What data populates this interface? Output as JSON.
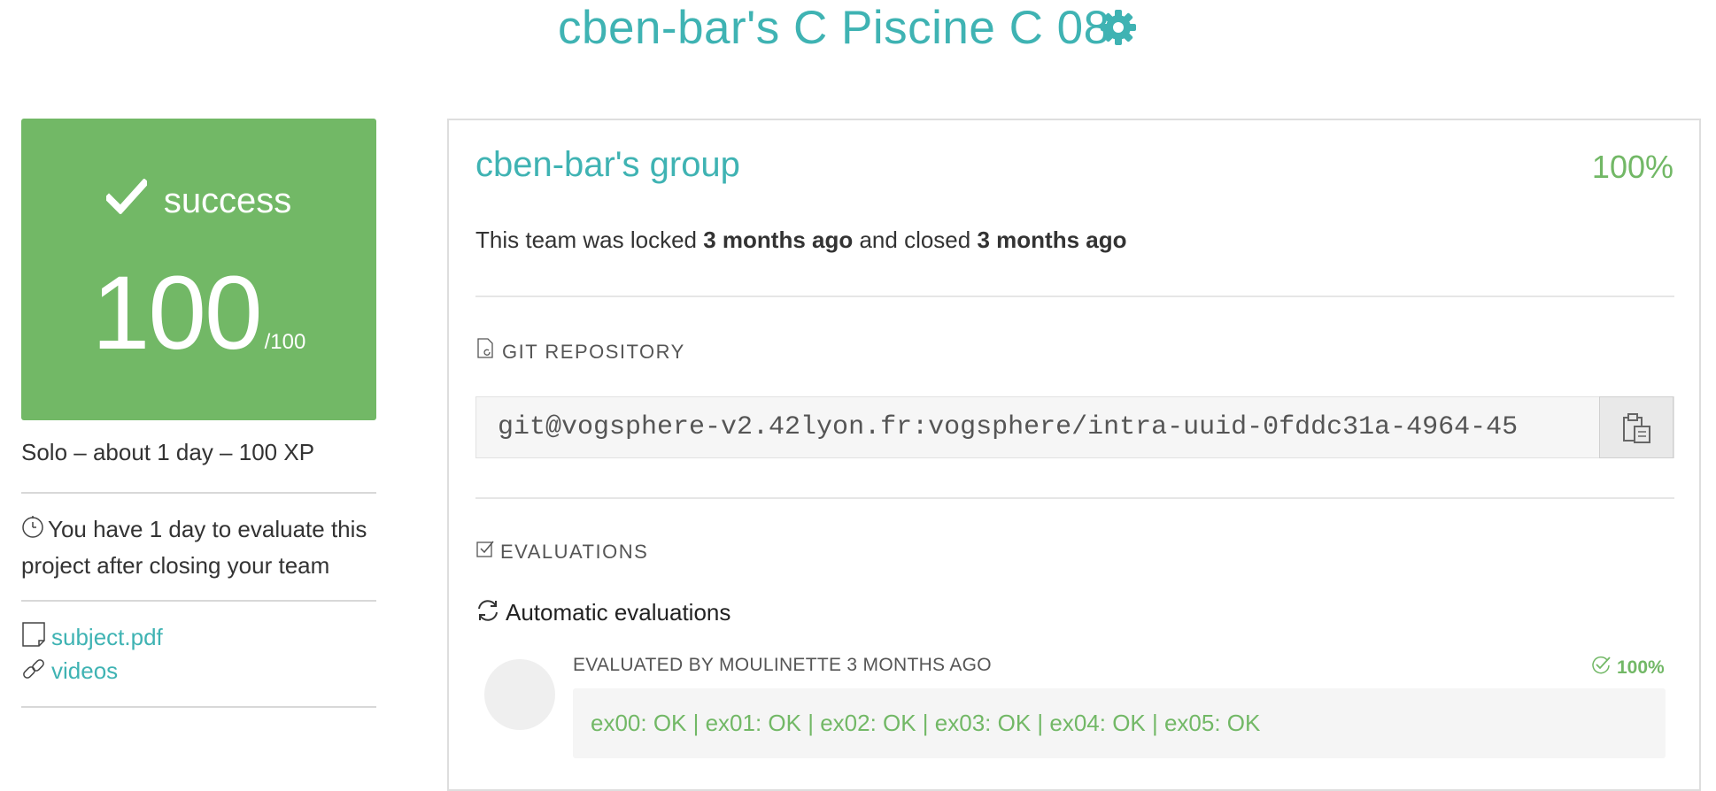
{
  "header": {
    "title": "cben-bar's C Piscine C 08",
    "settings_icon": "gear-icon"
  },
  "colors": {
    "accent": "#3fb3b3",
    "success": "#72b866"
  },
  "score_card": {
    "status": "success",
    "status_icon": "checkmark-icon",
    "score": "100",
    "max": "/100"
  },
  "sidebar": {
    "meta": "Solo – about 1 day – 100 XP",
    "eval_notice": "You have 1 day to evaluate this project after closing your team",
    "timer_icon": "stopwatch-icon",
    "links": [
      {
        "label": "subject.pdf",
        "icon": "document-icon"
      },
      {
        "label": "videos",
        "icon": "link-icon"
      }
    ]
  },
  "group": {
    "title": "cben-bar's group",
    "percent": "100%",
    "lock_prefix": "This team was locked",
    "locked_ago": "3 months ago",
    "lock_mid": "and closed",
    "closed_ago": "3 months ago"
  },
  "git": {
    "section_label": "GIT REPOSITORY",
    "url": "git@vogsphere-v2.42lyon.fr:vogsphere/intra-uuid-0fddc31a-4964-45",
    "copy_icon": "clipboard-icon"
  },
  "evaluations": {
    "section_label": "EVALUATIONS",
    "auto_title": "Automatic evaluations",
    "evaluated_by": "EVALUATED BY MOULINETTE 3 MONTHS AGO",
    "percent": "100%",
    "result": "ex00: OK | ex01: OK | ex02: OK | ex03: OK | ex04: OK | ex05: OK"
  }
}
